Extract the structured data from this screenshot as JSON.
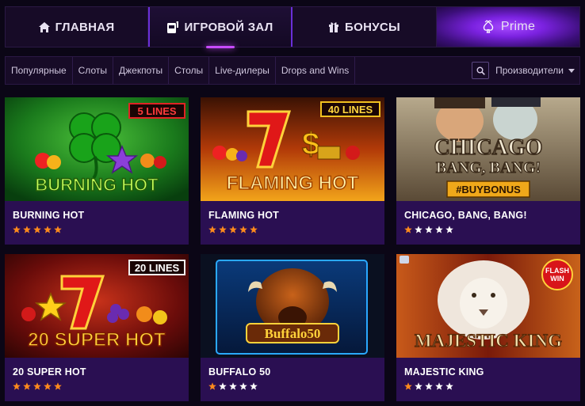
{
  "nav": {
    "home": "ГЛАВНАЯ",
    "games": "ИГРОВОЙ ЗАЛ",
    "bonuses": "БОНУСЫ",
    "prime": "Prime"
  },
  "filters": {
    "categories": [
      "Популярные",
      "Слоты",
      "Джекпоты",
      "Столы",
      "Live-дилеры",
      "Drops and Wins"
    ],
    "providers": "Производители"
  },
  "games": [
    {
      "title": "BURNING HOT",
      "rating": 5,
      "logo": "BURNING HOT",
      "badge": "5 LINES"
    },
    {
      "title": "FLAMING HOT",
      "rating": 5,
      "logo": "FLAMING HOT",
      "badge": "40 LINES"
    },
    {
      "title": "CHICAGO, BANG, BANG!",
      "rating": 1,
      "logo_line1": "CHICAGO",
      "logo_line2": "BANG, BANG!",
      "badge": "#BUYBONUS"
    },
    {
      "title": "20 SUPER HOT",
      "rating": 5,
      "logo": "20 SUPER HOT",
      "badge": "20 LINES"
    },
    {
      "title": "BUFFALO 50",
      "rating": 1,
      "logo": "Buffalo50"
    },
    {
      "title": "MAJESTIC KING",
      "rating": 1,
      "logo": "MAJESTIC KING",
      "badge_line1": "FLASH",
      "badge_line2": "WIN"
    }
  ],
  "colors": {
    "accent": "#c84bff",
    "card_bg": "#2a0f52",
    "star_filled": "#ff8a1c",
    "star_empty": "#ffffff"
  }
}
